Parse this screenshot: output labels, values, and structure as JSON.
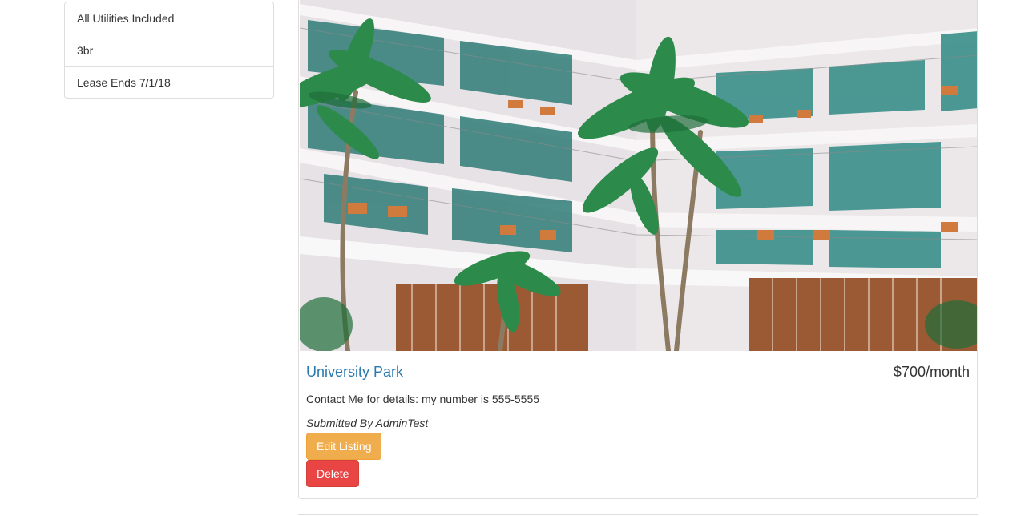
{
  "sidebar": {
    "items": [
      {
        "label": "All Utilities Included"
      },
      {
        "label": "3br"
      },
      {
        "label": "Lease Ends 7/1/18"
      }
    ]
  },
  "listing": {
    "title": "University Park",
    "price": "$700/month",
    "details": "Contact Me for details: my number is 555-5555",
    "submitted_by": "Submitted By AdminTest",
    "photo_icon": "apartment-photo",
    "actions": {
      "edit_label": "Edit Listing",
      "delete_label": "Delete"
    }
  },
  "colors": {
    "link": "#2a7ab0",
    "warning": "#f0ad4e",
    "danger": "#e94545",
    "border": "#dddddd"
  }
}
